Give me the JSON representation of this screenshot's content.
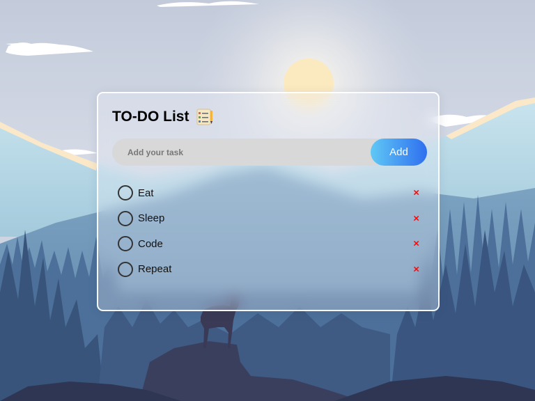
{
  "app": {
    "title": "TO-DO List",
    "title_icon": "checklist-icon"
  },
  "input": {
    "placeholder": "Add your task",
    "value": ""
  },
  "add_button": {
    "label": "Add"
  },
  "tasks": [
    {
      "label": "Eat",
      "done": false,
      "delete_label": "×"
    },
    {
      "label": "Sleep",
      "done": false,
      "delete_label": "×"
    },
    {
      "label": "Code",
      "done": false,
      "delete_label": "×"
    },
    {
      "label": "Repeat",
      "done": false,
      "delete_label": "×"
    }
  ],
  "colors": {
    "accent_start": "#60c8f5",
    "accent_end": "#2f6ff0",
    "delete": "#ee1111",
    "input_bg": "#d8d8d8"
  }
}
